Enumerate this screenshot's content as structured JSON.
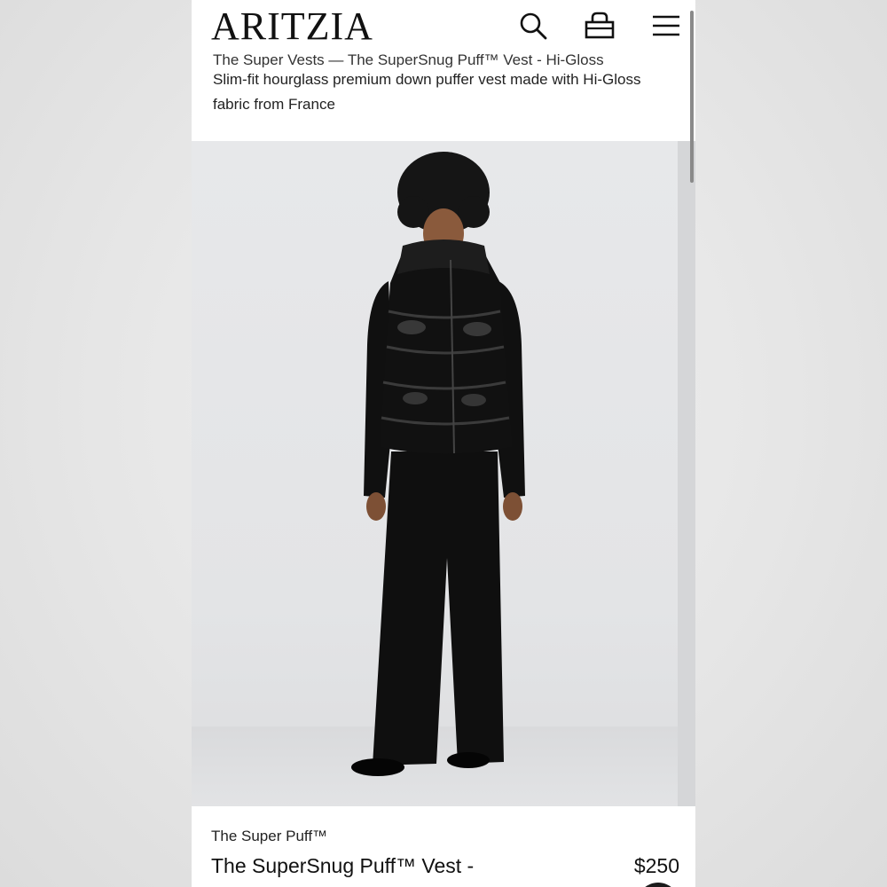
{
  "header": {
    "logo": "ARITZIA",
    "icons": [
      "search-icon",
      "bag-icon",
      "menu-icon"
    ]
  },
  "product_description": {
    "breadcrumb": "The Super Vests — The SuperSnug Puff™ Vest - Hi-Gloss",
    "summary": "Slim-fit hourglass premium down puffer vest made with Hi-Gloss fabric from France"
  },
  "product_image": {
    "subject": "model wearing black hi-gloss puffer vest"
  },
  "product_info": {
    "collection": "The Super Puff™",
    "name": "The SuperSnug Puff™ Vest -",
    "price": "$250"
  },
  "colors": {
    "brand_text": "#111111",
    "page_background": "#ffffff",
    "outer_background": "#e4e4e4",
    "swatch": "#1b1b1b"
  }
}
